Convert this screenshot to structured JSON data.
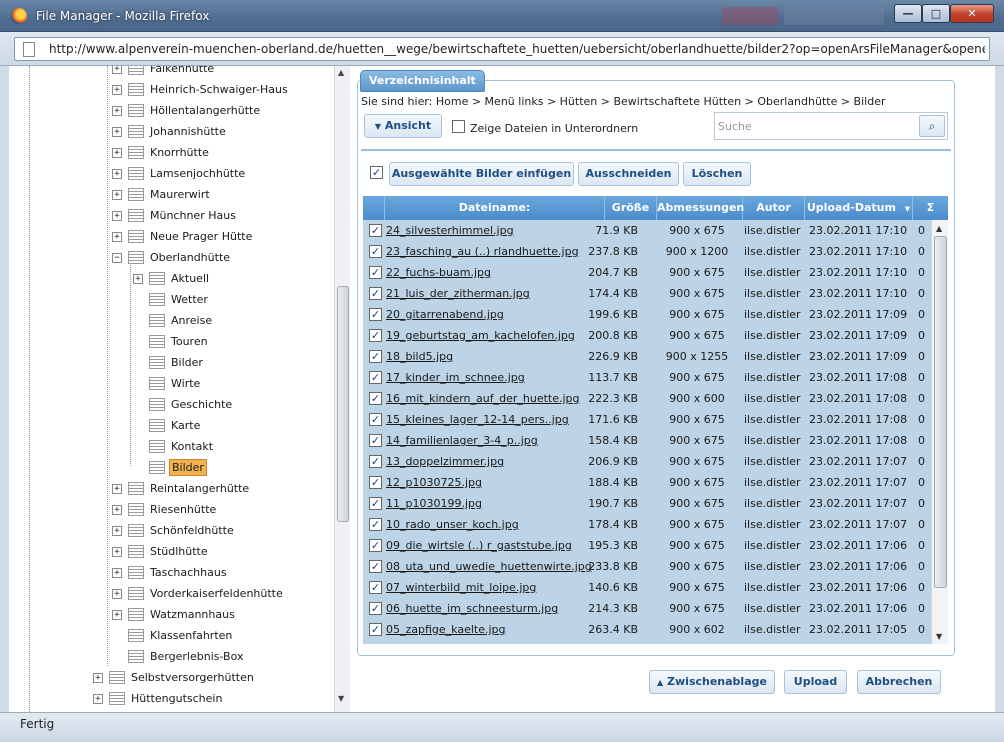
{
  "window": {
    "title": "File Manager - Mozilla Firefox",
    "min": "—",
    "max": "□",
    "close": "✕"
  },
  "address": {
    "url": "http://www.alpenverein-muenchen-oberland.de/huetten__wege/bewirtschaftete_huetten/uebersicht/oberlandhuette/bilder2?op=openArsFileManager&opener=imageGaller"
  },
  "tree": {
    "items": [
      {
        "label": "Falkenhütte",
        "level": 1,
        "exp": "+"
      },
      {
        "label": "Heinrich-Schwaiger-Haus",
        "level": 1,
        "exp": "+"
      },
      {
        "label": "Höllentalangerhütte",
        "level": 1,
        "exp": "+"
      },
      {
        "label": "Johannishütte",
        "level": 1,
        "exp": "+"
      },
      {
        "label": "Knorrhütte",
        "level": 1,
        "exp": "+"
      },
      {
        "label": "Lamsenjochhütte",
        "level": 1,
        "exp": "+"
      },
      {
        "label": "Maurerwirt",
        "level": 1,
        "exp": "+"
      },
      {
        "label": "Münchner Haus",
        "level": 1,
        "exp": "+"
      },
      {
        "label": "Neue Prager Hütte",
        "level": 1,
        "exp": "+"
      },
      {
        "label": "Oberlandhütte",
        "level": 1,
        "exp": "−"
      },
      {
        "label": "Aktuell",
        "level": 2,
        "exp": "+"
      },
      {
        "label": "Wetter",
        "level": 2,
        "exp": ""
      },
      {
        "label": "Anreise",
        "level": 2,
        "exp": ""
      },
      {
        "label": "Touren",
        "level": 2,
        "exp": ""
      },
      {
        "label": "Bilder",
        "level": 2,
        "exp": ""
      },
      {
        "label": "Wirte",
        "level": 2,
        "exp": ""
      },
      {
        "label": "Geschichte",
        "level": 2,
        "exp": ""
      },
      {
        "label": "Karte",
        "level": 2,
        "exp": ""
      },
      {
        "label": "Kontakt",
        "level": 2,
        "exp": ""
      },
      {
        "label": "Bilder",
        "level": 2,
        "exp": "",
        "selected": true
      },
      {
        "label": "Reintalangerhütte",
        "level": 1,
        "exp": "+"
      },
      {
        "label": "Riesenhütte",
        "level": 1,
        "exp": "+"
      },
      {
        "label": "Schönfeldhütte",
        "level": 1,
        "exp": "+"
      },
      {
        "label": "Stüdlhütte",
        "level": 1,
        "exp": "+"
      },
      {
        "label": "Taschachhaus",
        "level": 1,
        "exp": "+"
      },
      {
        "label": "Vorderkaiserfeldenhütte",
        "level": 1,
        "exp": "+"
      },
      {
        "label": "Watzmannhaus",
        "level": 1,
        "exp": "+"
      },
      {
        "label": "Klassenfahrten",
        "level": 1,
        "exp": ""
      },
      {
        "label": "Bergerlebnis-Box",
        "level": 1,
        "exp": ""
      },
      {
        "label": "Selbstversorgerhütten",
        "level": 0,
        "exp": "+"
      },
      {
        "label": "Hüttengutschein",
        "level": 0,
        "exp": "+"
      }
    ]
  },
  "panel": {
    "tab": "Verzeichnisinhalt",
    "breadcrumb": "Sie sind hier: Home > Menü links > Hütten > Bewirtschaftete Hütten > Oberlandhütte > Bilder",
    "view_button": "Ansicht",
    "view_arrow": "▼",
    "subfolders_label": "Zeige Dateien in Unterordnern",
    "search_placeholder": "Suche",
    "search_icon": "⌕",
    "insert_button": "Ausgewählte Bilder einfügen",
    "cut_button": "Ausschneiden",
    "delete_button": "Löschen",
    "clipboard_button": "Zwischenablage",
    "clipboard_arrow": "▲",
    "upload_button": "Upload",
    "cancel_button": "Abbrechen",
    "check": "✓"
  },
  "grid": {
    "columns": [
      "Dateiname:",
      "Größe",
      "Abmessungen",
      "Autor",
      "Upload-Datum",
      "Σ"
    ],
    "sort_arrow": "▼",
    "rows": [
      [
        "24_silvesterhimmel.jpg",
        "71.9 KB",
        "900 x 675",
        "ilse.distler",
        "23.02.2011 17:10",
        "0"
      ],
      [
        "23_fasching_au (..) rlandhuette.jpg",
        "237.8 KB",
        "900 x 1200",
        "ilse.distler",
        "23.02.2011 17:10",
        "0"
      ],
      [
        "22_fuchs-buam.jpg",
        "204.7 KB",
        "900 x 675",
        "ilse.distler",
        "23.02.2011 17:10",
        "0"
      ],
      [
        "21_luis_der_zitherman.jpg",
        "174.4 KB",
        "900 x 675",
        "ilse.distler",
        "23.02.2011 17:10",
        "0"
      ],
      [
        "20_gitarrenabend.jpg",
        "199.6 KB",
        "900 x 675",
        "ilse.distler",
        "23.02.2011 17:09",
        "0"
      ],
      [
        "19_geburtstag_am_kachelofen.jpg",
        "200.8 KB",
        "900 x 675",
        "ilse.distler",
        "23.02.2011 17:09",
        "0"
      ],
      [
        "18_bild5.jpg",
        "226.9 KB",
        "900 x 1255",
        "ilse.distler",
        "23.02.2011 17:09",
        "0"
      ],
      [
        "17_kinder_im_schnee.jpg",
        "113.7 KB",
        "900 x 675",
        "ilse.distler",
        "23.02.2011 17:08",
        "0"
      ],
      [
        "16_mit_kindern_auf_der_huette.jpg",
        "222.3 KB",
        "900 x 600",
        "ilse.distler",
        "23.02.2011 17:08",
        "0"
      ],
      [
        "15_kleines_lager_12-14_pers..jpg",
        "171.6 KB",
        "900 x 675",
        "ilse.distler",
        "23.02.2011 17:08",
        "0"
      ],
      [
        "14_familienlager_3-4_p..jpg",
        "158.4 KB",
        "900 x 675",
        "ilse.distler",
        "23.02.2011 17:08",
        "0"
      ],
      [
        "13_doppelzimmer.jpg",
        "206.9 KB",
        "900 x 675",
        "ilse.distler",
        "23.02.2011 17:07",
        "0"
      ],
      [
        "12_p1030725.jpg",
        "188.4 KB",
        "900 x 675",
        "ilse.distler",
        "23.02.2011 17:07",
        "0"
      ],
      [
        "11_p1030199.jpg",
        "190.7 KB",
        "900 x 675",
        "ilse.distler",
        "23.02.2011 17:07",
        "0"
      ],
      [
        "10_rado_unser_koch.jpg",
        "178.4 KB",
        "900 x 675",
        "ilse.distler",
        "23.02.2011 17:07",
        "0"
      ],
      [
        "09_die_wirtsle (..) r_gaststube.jpg",
        "195.3 KB",
        "900 x 675",
        "ilse.distler",
        "23.02.2011 17:06",
        "0"
      ],
      [
        "08_uta_und_uwedie_huettenwirte.jpg",
        "233.8 KB",
        "900 x 675",
        "ilse.distler",
        "23.02.2011 17:06",
        "0"
      ],
      [
        "07_winterbild_mit_loipe.jpg",
        "140.6 KB",
        "900 x 675",
        "ilse.distler",
        "23.02.2011 17:06",
        "0"
      ],
      [
        "06_huette_im_schneesturm.jpg",
        "214.3 KB",
        "900 x 675",
        "ilse.distler",
        "23.02.2011 17:06",
        "0"
      ],
      [
        "05_zapfige_kaelte.jpg",
        "263.4 KB",
        "900 x 602",
        "ilse.distler",
        "23.02.2011 17:05",
        "0"
      ]
    ]
  },
  "status": {
    "text": "Fertig"
  }
}
